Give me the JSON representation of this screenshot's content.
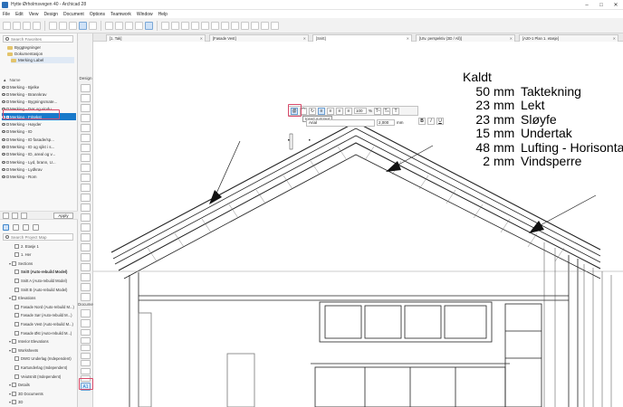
{
  "window": {
    "title": "Hytte Ørholmsvegen 40 - Archicad 28",
    "controls": [
      "–",
      "□",
      "✕"
    ]
  },
  "menu": [
    "File",
    "Edit",
    "View",
    "Design",
    "Document",
    "Options",
    "Teamwork",
    "Window",
    "Help"
  ],
  "navigator": {
    "search_placeholder": "Search Favorites",
    "favorites": [
      "Byggtegninger",
      "Dokumentasjon",
      "Merking Label"
    ],
    "column_header": "Name",
    "layers": [
      "Merking - Bjelke",
      "Merking - Brannkrav",
      "Merking - Bygningsmate...",
      "Merking - Dør og vindu",
      "Merking - Fritekst",
      "Merking - Høyder",
      "Merking - ID",
      "Merking - ID fasade/sp...",
      "Merking - ID og sjikt i s...",
      "Merking - ID, areal og v...",
      "Merking - Lyd, brann, U...",
      "Merking - Lydkrav",
      "Merking - Rom"
    ],
    "selected_layer_index": 4,
    "apply_label": "Apply",
    "project_search_placeholder": "Search Project Map",
    "tree": [
      {
        "label": "2. Etasje 1",
        "indent": 2,
        "bold": false
      },
      {
        "label": "1. Her",
        "indent": 2,
        "bold": false
      },
      {
        "label": "Sections",
        "indent": 1,
        "bold": false
      },
      {
        "label": "Snitt (Auto-rebuild Model)",
        "indent": 2,
        "bold": true
      },
      {
        "label": "Snitt A (Auto-rebuild Model)",
        "indent": 2,
        "bold": false
      },
      {
        "label": "Snitt B (Auto-rebuild Model)",
        "indent": 2,
        "bold": false
      },
      {
        "label": "Elevations",
        "indent": 1,
        "bold": false
      },
      {
        "label": "Fasade Nord (Auto-rebuild M...)",
        "indent": 2,
        "bold": false
      },
      {
        "label": "Fasade Sør (Auto-rebuild M...)",
        "indent": 2,
        "bold": false
      },
      {
        "label": "Fasade Vest (Auto-rebuild M...)",
        "indent": 2,
        "bold": false
      },
      {
        "label": "Fasade Øst (Auto-rebuild M...)",
        "indent": 2,
        "bold": false
      },
      {
        "label": "Interior Elevations",
        "indent": 1,
        "bold": false
      },
      {
        "label": "Worksheets",
        "indent": 1,
        "bold": false
      },
      {
        "label": "DWG Underlag (Independent)",
        "indent": 2,
        "bold": false
      },
      {
        "label": "Kartunderlag (Independent)",
        "indent": 2,
        "bold": false
      },
      {
        "label": "Veiutsnitt (Independent)",
        "indent": 2,
        "bold": false
      },
      {
        "label": "Details",
        "indent": 1,
        "bold": false
      },
      {
        "label": "3D Documents",
        "indent": 1,
        "bold": false
      },
      {
        "label": "3D",
        "indent": 1,
        "bold": false
      },
      {
        "label": "Generic Perspective",
        "indent": 2,
        "bold": false
      }
    ]
  },
  "toolbox": {
    "design_label": "Design",
    "document_label": "Docume"
  },
  "tabs": [
    {
      "label": "[1. Tak]",
      "active": false
    },
    {
      "label": "[Fasade Vest]",
      "active": false
    },
    {
      "label": "[Snitt]",
      "active": true
    },
    {
      "label": "[Utv. perspektiv (3D / All)]",
      "active": false
    },
    {
      "label": "[A20-1 Plan 1. etasje]",
      "active": false
    }
  ],
  "text_toolbar": {
    "tooltip": "Insert Autotext",
    "size_value": "100",
    "size_unit": "%",
    "height_value": "2,000",
    "height_unit": "mm",
    "font_value": "Arial",
    "bold": "B",
    "italic": "I",
    "underline": "U",
    "strike": "T"
  },
  "annotation": {
    "heading": "Kaldt",
    "rows": [
      {
        "value": "50",
        "unit": "mm",
        "text": "Taktekning"
      },
      {
        "value": "23",
        "unit": "mm",
        "text": "Lekt"
      },
      {
        "value": "23",
        "unit": "mm",
        "text": "Sløyfe"
      },
      {
        "value": "15",
        "unit": "mm",
        "text": "Undertak"
      },
      {
        "value": "48",
        "unit": "mm",
        "text": "Lufting - Horisontalt"
      },
      {
        "value": "2",
        "unit": "mm",
        "text": "Vindsperre"
      }
    ]
  },
  "colors": {
    "accent": "#1979ca",
    "highlight": "#d94a6a"
  }
}
